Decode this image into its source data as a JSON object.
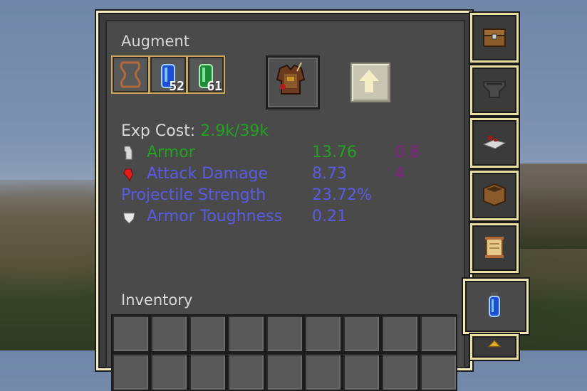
{
  "panel": {
    "title": "Augment",
    "inventory_title": "Inventory"
  },
  "augment_slots": [
    {
      "name": "scroll-slot",
      "icon": "empty-scroll-icon",
      "count": ""
    },
    {
      "name": "blue-potion-slot",
      "icon": "blue-potion-icon",
      "count": "52"
    },
    {
      "name": "green-potion-slot",
      "icon": "green-potion-icon",
      "count": "61"
    }
  ],
  "item_slot": {
    "icon": "leather-armor-icon"
  },
  "confirm_button": {
    "icon": "up-arrow-icon"
  },
  "exp_cost": {
    "label": "Exp Cost:",
    "value": "2.9k/39k"
  },
  "stats": [
    {
      "icon": "armor-icon",
      "label": "Armor",
      "value": "13.76",
      "bonus": "0.8",
      "color": "#21a321",
      "bonus_color": "#8b1e8b"
    },
    {
      "icon": "heart-icon",
      "label": "Attack Damage",
      "value": "8.73",
      "bonus": "4",
      "color": "#5a5ae6",
      "bonus_color": "#8b1e8b"
    },
    {
      "icon": "",
      "label": "Projectile Strength",
      "value": "23.72%",
      "bonus": "",
      "color": "#5a5ae6",
      "bonus_color": "#8b1e8b"
    },
    {
      "icon": "shield-icon",
      "label": "Armor Toughness",
      "value": "0.21",
      "bonus": "",
      "color": "#5a5ae6",
      "bonus_color": "#8b1e8b"
    }
  ],
  "side_tabs": [
    {
      "icon": "chest-icon"
    },
    {
      "icon": "hopper-icon"
    },
    {
      "icon": "sword-stand-icon"
    },
    {
      "icon": "barrel-icon"
    },
    {
      "icon": "scroll-icon"
    },
    {
      "icon": "potion-tab-icon"
    },
    {
      "icon": "gold-item-icon"
    }
  ],
  "colors": {
    "exp_value": "#21a321",
    "text_gray": "#d8d8d8"
  }
}
